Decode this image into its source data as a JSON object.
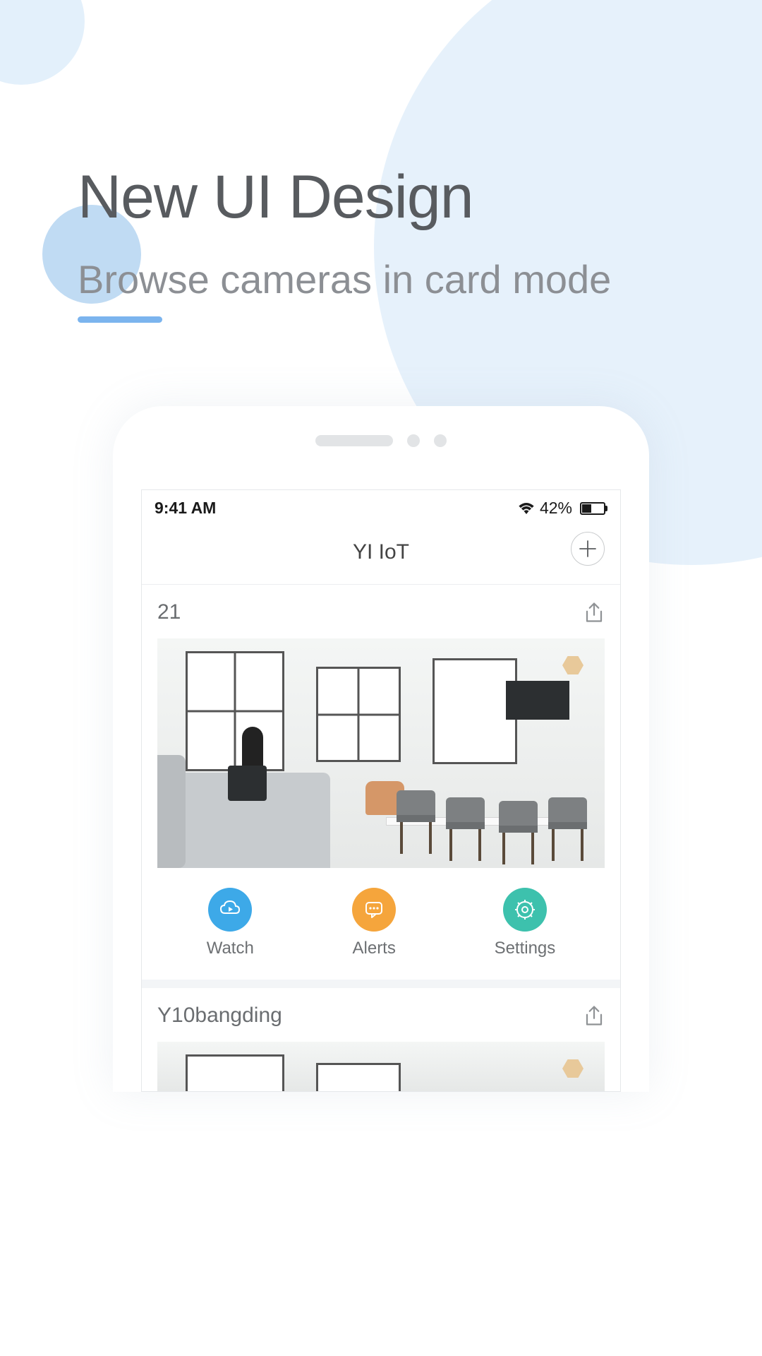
{
  "hero": {
    "title": "New UI Design",
    "subtitle": "Browse cameras in card mode"
  },
  "statusbar": {
    "time": "9:41 AM",
    "battery_pct": "42%"
  },
  "app": {
    "title": "YI IoT"
  },
  "cards": [
    {
      "name": "21"
    },
    {
      "name": "Y10bangding"
    }
  ],
  "actions": {
    "watch": "Watch",
    "alerts": "Alerts",
    "settings": "Settings"
  }
}
